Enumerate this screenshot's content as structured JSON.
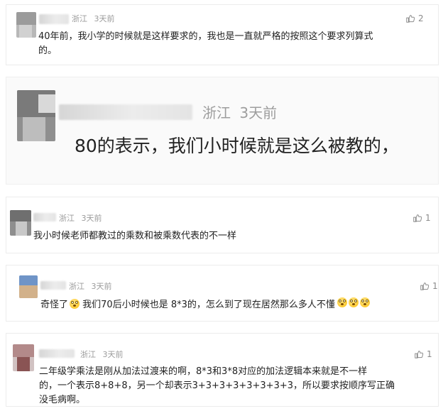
{
  "comments": [
    {
      "location": "浙江",
      "time": "3天前",
      "likes": "2",
      "text_lines": [
        "40年前，我小学的时候就是这样要求的，我也是一直就严格的按照这个要求列算式",
        "的。"
      ]
    },
    {
      "location": "浙江",
      "time": "3天前",
      "likes": "",
      "text_lines": [
        "80的表示，我们小时候就是这么被教的，"
      ]
    },
    {
      "location": "浙江",
      "time": "3天前",
      "likes": "1",
      "text_lines": [
        "我小时候老师都教过的乘数和被乘数代表的不一样"
      ]
    },
    {
      "location": "浙江",
      "time": "3天前",
      "likes": "1",
      "text_lines": [
        "奇怪了",
        "我们70后小时候也是 8*3的，怎么到了现在居然那么多人不懂"
      ]
    },
    {
      "location": "浙江",
      "time": "3天前",
      "likes": "1",
      "text_lines": [
        "二年级学乘法是刚从加法过渡来的啊，8*3和3*8对应的加法逻辑本来就是不一样",
        "的，一个表示8+8+8，另一个却表示3+3+3+3+3+3+3+3，所以要求按顺序写正确",
        "没毛病啊。"
      ]
    }
  ],
  "icons": {
    "like": "thumb-up-icon",
    "emoji": "flushed-face-emoji-icon"
  },
  "colors": {
    "meta": "#9b9b9b",
    "text": "#222222",
    "border": "#ececec",
    "emoji": "#ffcf3f"
  }
}
